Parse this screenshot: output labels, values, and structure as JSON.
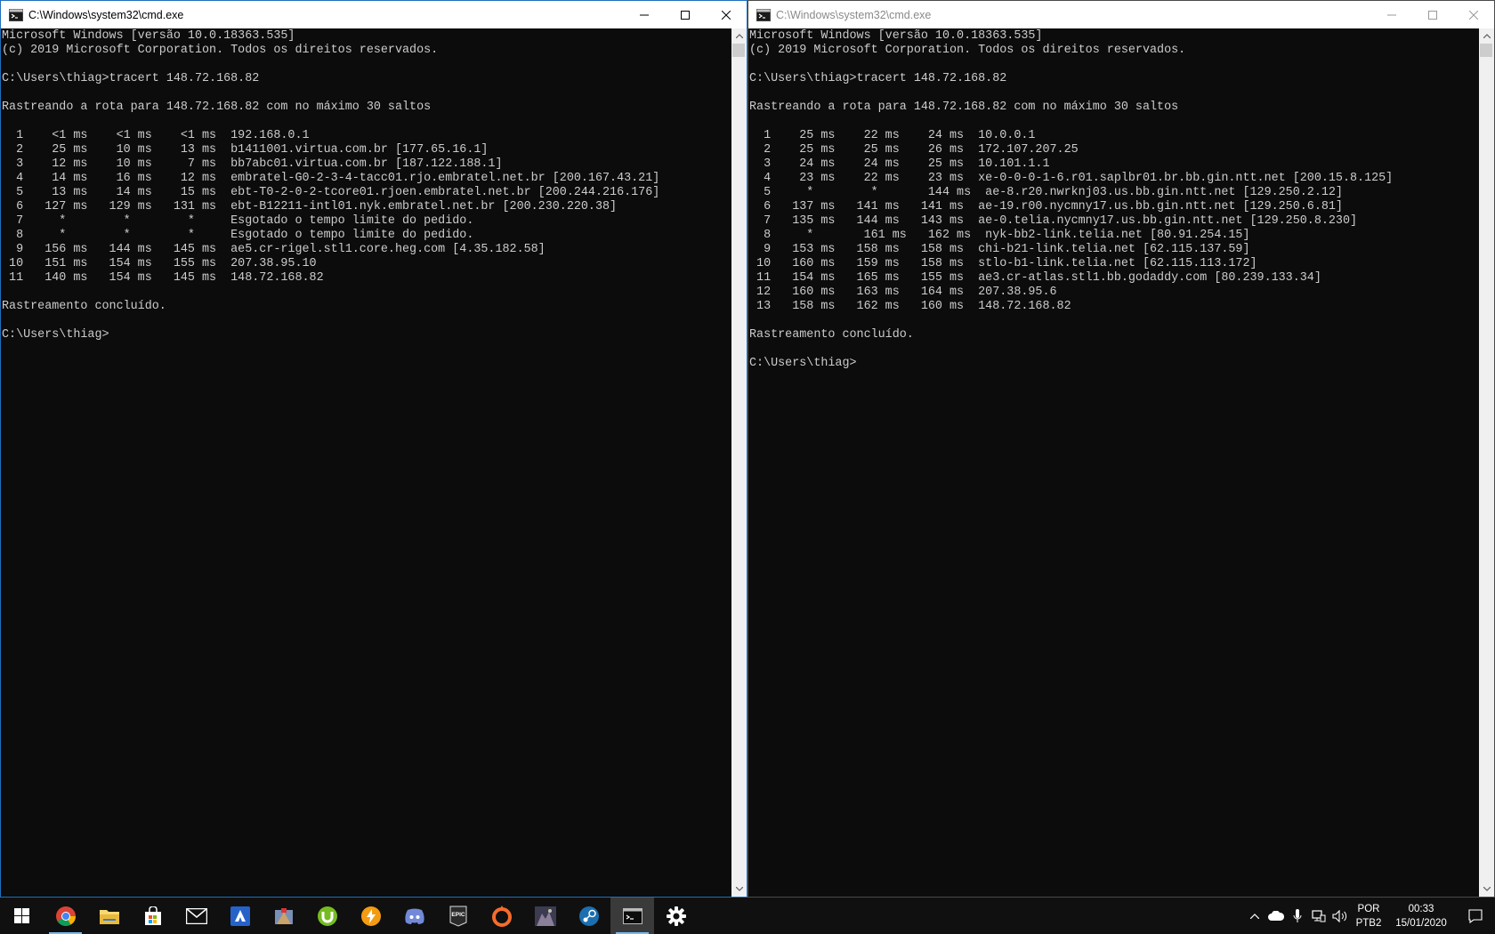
{
  "windows": [
    {
      "title": "C:\\Windows\\system32\\cmd.exe",
      "active": true,
      "lines": [
        "Microsoft Windows [versão 10.0.18363.535]",
        "(c) 2019 Microsoft Corporation. Todos os direitos reservados.",
        "",
        "C:\\Users\\thiag>tracert 148.72.168.82",
        "",
        "Rastreando a rota para 148.72.168.82 com no máximo 30 saltos",
        "",
        "  1    <1 ms    <1 ms    <1 ms  192.168.0.1",
        "  2    25 ms    10 ms    13 ms  b1411001.virtua.com.br [177.65.16.1]",
        "  3    12 ms    10 ms     7 ms  bb7abc01.virtua.com.br [187.122.188.1]",
        "  4    14 ms    16 ms    12 ms  embratel-G0-2-3-4-tacc01.rjo.embratel.net.br [200.167.43.21]",
        "  5    13 ms    14 ms    15 ms  ebt-T0-2-0-2-tcore01.rjoen.embratel.net.br [200.244.216.176]",
        "  6   127 ms   129 ms   131 ms  ebt-B12211-intl01.nyk.embratel.net.br [200.230.220.38]",
        "  7     *        *        *     Esgotado o tempo limite do pedido.",
        "  8     *        *        *     Esgotado o tempo limite do pedido.",
        "  9   156 ms   144 ms   145 ms  ae5.cr-rigel.stl1.core.heg.com [4.35.182.58]",
        " 10   151 ms   154 ms   155 ms  207.38.95.10",
        " 11   140 ms   154 ms   145 ms  148.72.168.82",
        "",
        "Rastreamento concluído.",
        "",
        "C:\\Users\\thiag>"
      ]
    },
    {
      "title": "C:\\Windows\\system32\\cmd.exe",
      "active": false,
      "lines": [
        "Microsoft Windows [versão 10.0.18363.535]",
        "(c) 2019 Microsoft Corporation. Todos os direitos reservados.",
        "",
        "C:\\Users\\thiag>tracert 148.72.168.82",
        "",
        "Rastreando a rota para 148.72.168.82 com no máximo 30 saltos",
        "",
        "  1    25 ms    22 ms    24 ms  10.0.0.1",
        "  2    25 ms    25 ms    26 ms  172.107.207.25",
        "  3    24 ms    24 ms    25 ms  10.101.1.1",
        "  4    23 ms    22 ms    23 ms  xe-0-0-0-1-6.r01.saplbr01.br.bb.gin.ntt.net [200.15.8.125]",
        "  5     *        *       144 ms  ae-8.r20.nwrknj03.us.bb.gin.ntt.net [129.250.2.12]",
        "  6   137 ms   141 ms   141 ms  ae-19.r00.nycmny17.us.bb.gin.ntt.net [129.250.6.81]",
        "  7   135 ms   144 ms   143 ms  ae-0.telia.nycmny17.us.bb.gin.ntt.net [129.250.8.230]",
        "  8     *       161 ms   162 ms  nyk-bb2-link.telia.net [80.91.254.15]",
        "  9   153 ms   158 ms   158 ms  chi-b21-link.telia.net [62.115.137.59]",
        " 10   160 ms   159 ms   158 ms  stlo-b1-link.telia.net [62.115.113.172]",
        " 11   154 ms   165 ms   155 ms  ae3.cr-atlas.stl1.bb.godaddy.com [80.239.133.34]",
        " 12   160 ms   163 ms   164 ms  207.38.95.6",
        " 13   158 ms   162 ms   160 ms  148.72.168.82",
        "",
        "Rastreamento concluído.",
        "",
        "C:\\Users\\thiag>"
      ]
    }
  ],
  "taskbar": {
    "apps": [
      {
        "name": "start-icon",
        "running": false,
        "active": false
      },
      {
        "name": "chrome-icon",
        "running": true,
        "active": false
      },
      {
        "name": "file-explorer-icon",
        "running": false,
        "active": false
      },
      {
        "name": "store-icon",
        "running": false,
        "active": false
      },
      {
        "name": "mail-icon",
        "running": false,
        "active": false
      },
      {
        "name": "azure-icon",
        "running": false,
        "active": false
      },
      {
        "name": "game-app-icon",
        "running": false,
        "active": false
      },
      {
        "name": "utorrent-icon",
        "running": false,
        "active": false
      },
      {
        "name": "winamp-icon",
        "running": false,
        "active": false
      },
      {
        "name": "discord-icon",
        "running": false,
        "active": false
      },
      {
        "name": "epic-games-icon",
        "running": false,
        "active": false
      },
      {
        "name": "origin-icon",
        "running": false,
        "active": false
      },
      {
        "name": "game-launcher-icon",
        "running": false,
        "active": false
      },
      {
        "name": "steam-icon",
        "running": false,
        "active": false
      },
      {
        "name": "cmd-icon",
        "running": true,
        "active": true
      },
      {
        "name": "settings-icon",
        "running": false,
        "active": false
      }
    ],
    "epic_label": "EPIC",
    "tray": {
      "language": "POR",
      "keyboard": "PTB2",
      "time": "00:33",
      "date": "15/01/2020"
    }
  }
}
